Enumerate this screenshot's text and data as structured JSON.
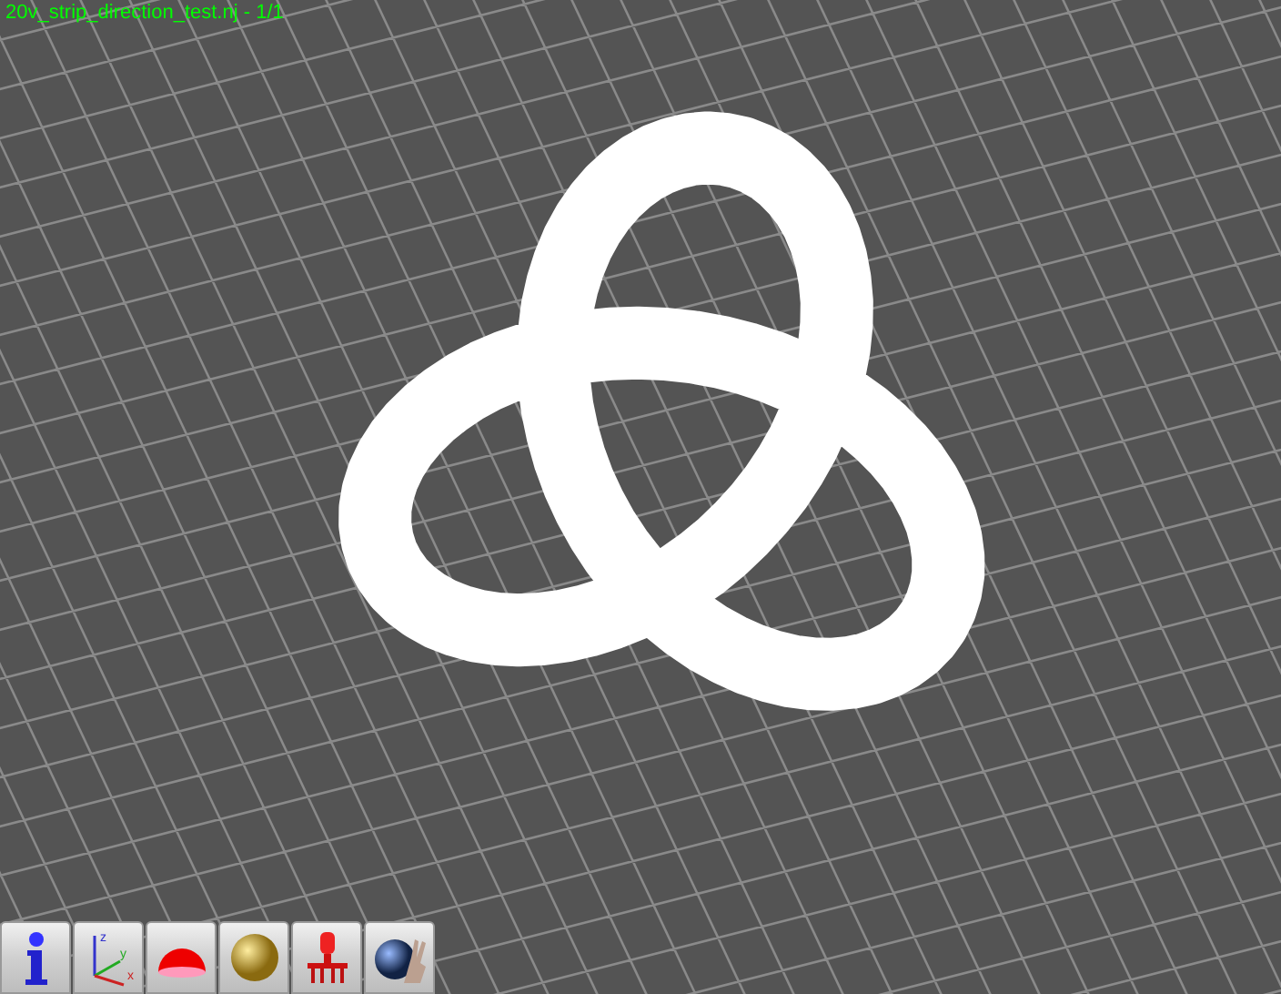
{
  "viewport": {
    "title": "20v_strip_direction_test.nj - 1/1"
  },
  "toolbar": [
    {
      "kind": "info"
    },
    {
      "kind": "axes",
      "axis_labels": [
        "z",
        "y",
        "x"
      ]
    },
    {
      "kind": "dome"
    },
    {
      "kind": "sphere"
    },
    {
      "kind": "robot"
    },
    {
      "kind": "hand"
    }
  ]
}
